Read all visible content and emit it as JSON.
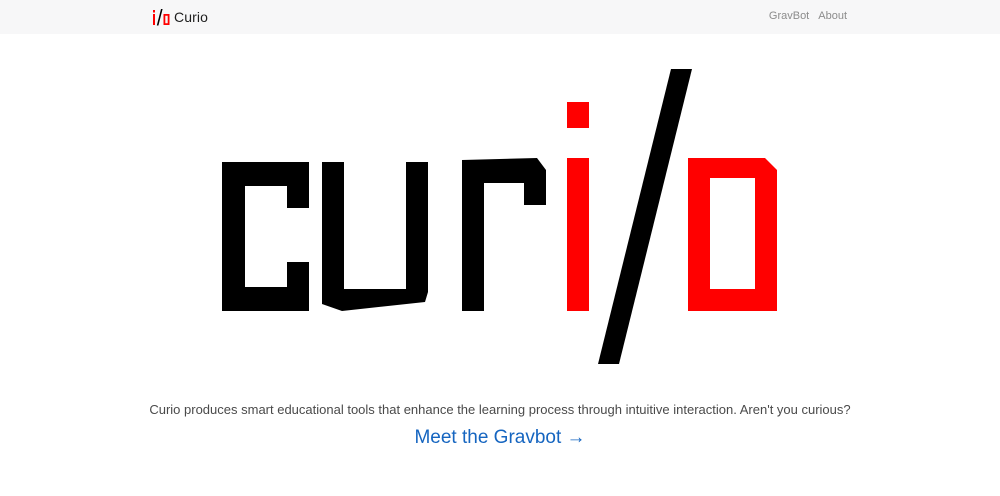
{
  "navbar": {
    "brand_name": "Curio",
    "links": [
      "GravBot",
      "About"
    ]
  },
  "hero": {
    "logo_text": "curi/o",
    "logo_colors": {
      "dark": "#000000",
      "accent": "#ff0000"
    }
  },
  "tagline": "Curio produces smart educational tools that enhance the learning process through intuitive interaction. Aren't you curious?",
  "cta": {
    "label": "Meet the Gravbot →"
  },
  "colors": {
    "link": "#1565c0",
    "navbar_bg": "#f7f7f8"
  }
}
